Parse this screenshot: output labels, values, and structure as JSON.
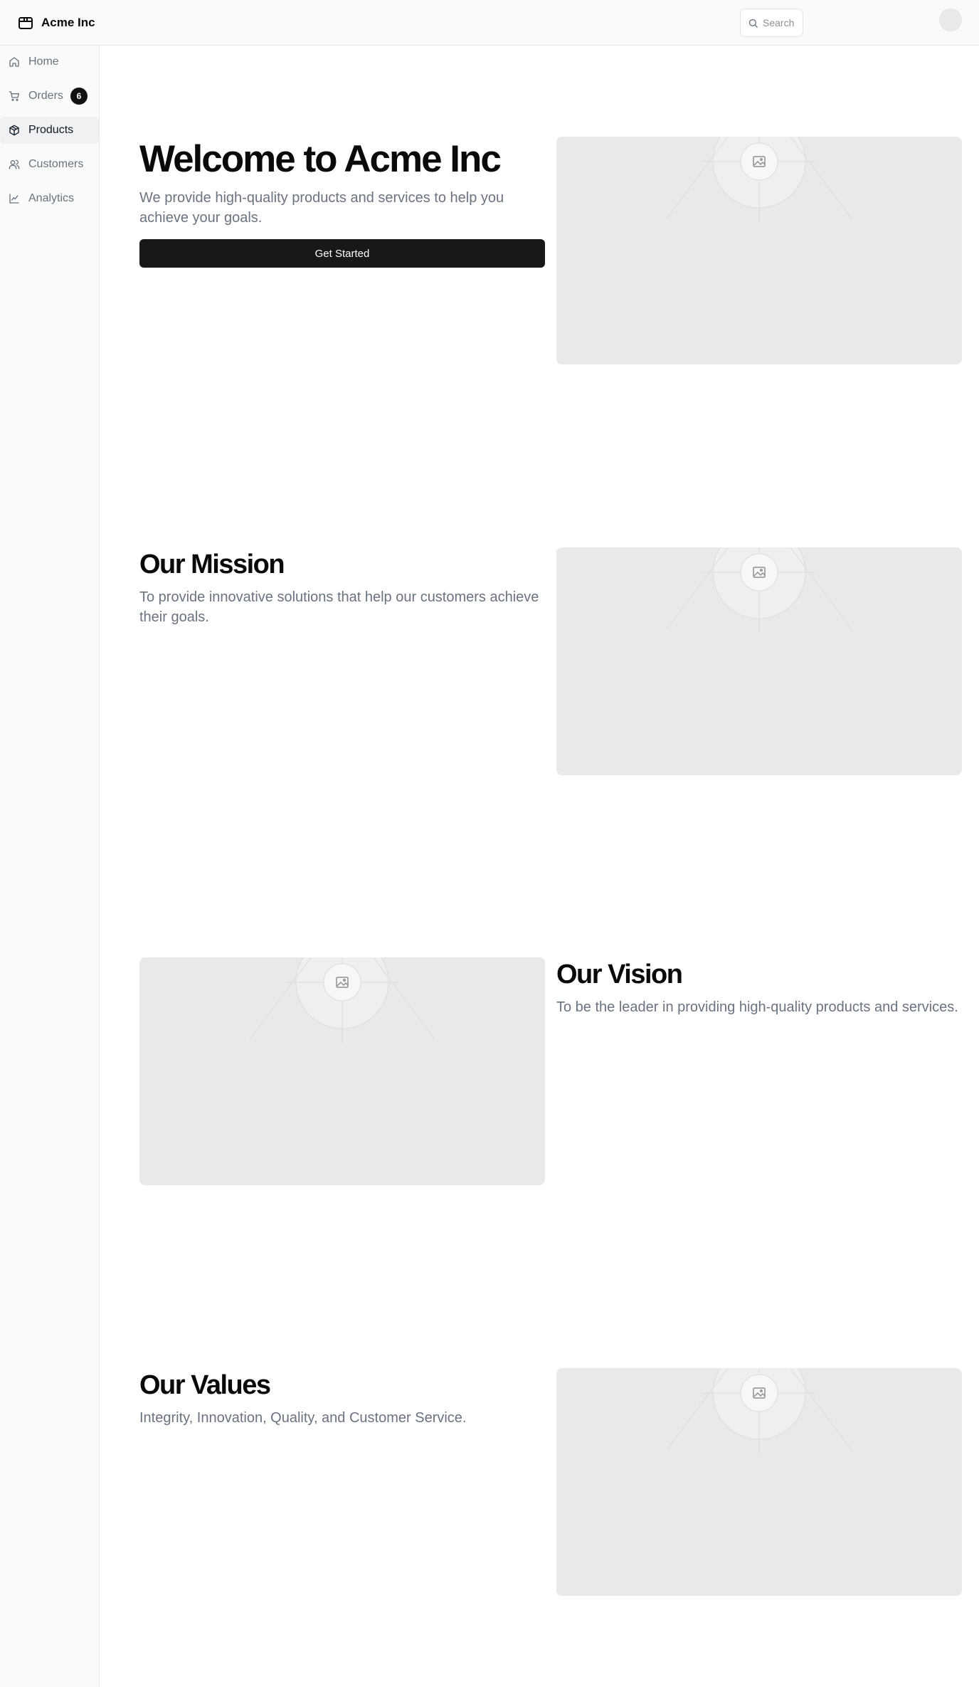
{
  "header": {
    "brand_name": "Acme Inc",
    "search_placeholder": "Search"
  },
  "sidebar": {
    "items": [
      {
        "label": "Home",
        "icon": "home-icon"
      },
      {
        "label": "Orders",
        "icon": "cart-icon",
        "badge": "6"
      },
      {
        "label": "Products",
        "icon": "package-icon",
        "active": true
      },
      {
        "label": "Customers",
        "icon": "users-icon"
      },
      {
        "label": "Analytics",
        "icon": "line-chart-icon"
      }
    ]
  },
  "hero": {
    "title": "Welcome to Acme Inc",
    "description": "We provide high-quality products and services to help you achieve your goals.",
    "cta_label": "Get Started"
  },
  "mission": {
    "title": "Our Mission",
    "description": "To provide innovative solutions that help our customers achieve their goals."
  },
  "vision": {
    "title": "Our Vision",
    "description": "To be the leader in providing high-quality products and services."
  },
  "values": {
    "title": "Our Values",
    "description": "Integrity, Innovation, Quality, and Customer Service."
  },
  "colors": {
    "primary_button": "#18181b",
    "muted_text": "#6b7280",
    "placeholder_bg": "#e9e9e9",
    "sidebar_bg": "#f9fafa"
  }
}
